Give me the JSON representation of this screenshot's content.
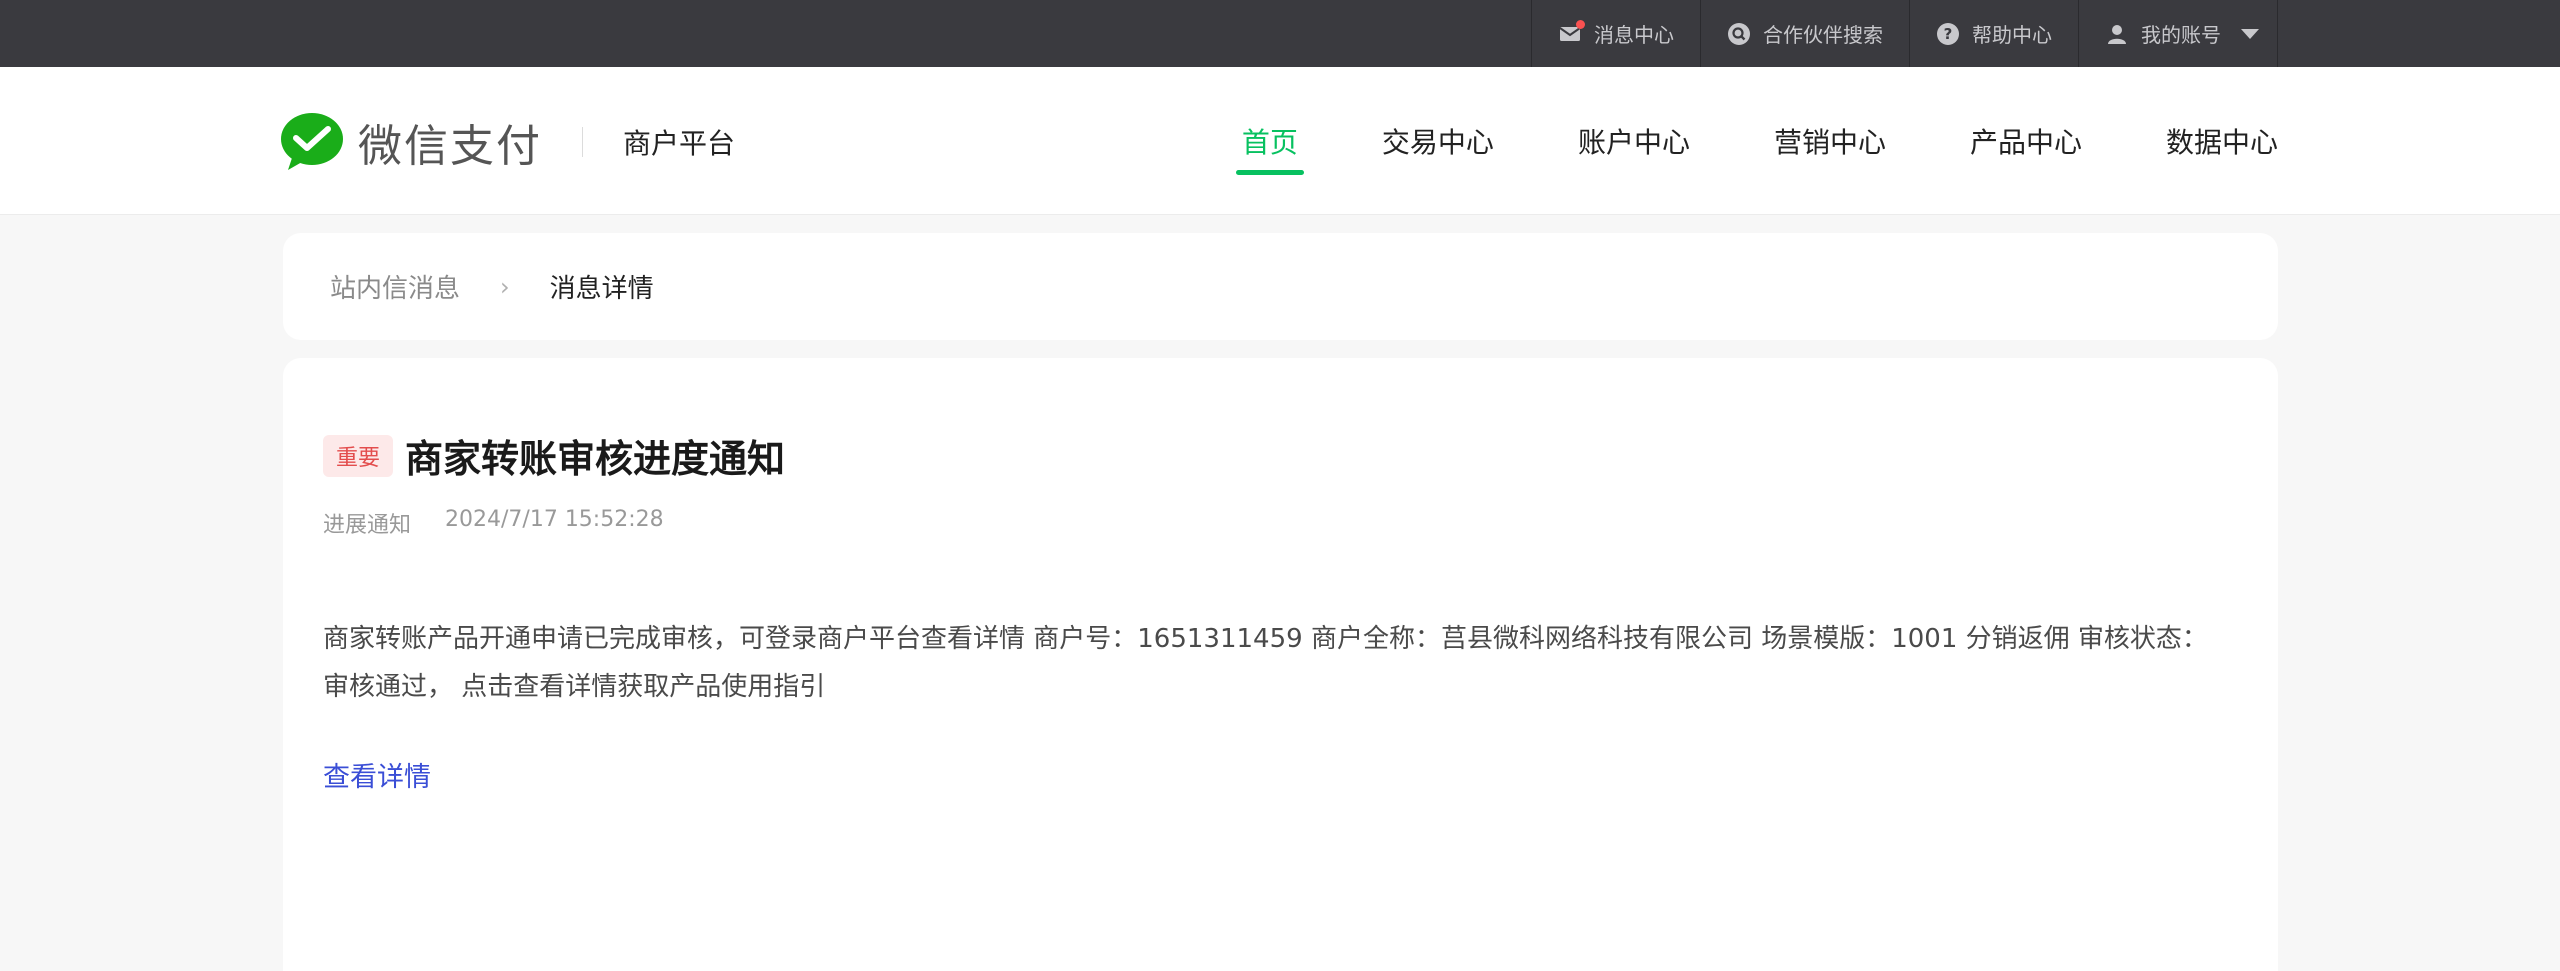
{
  "topbar": {
    "items": [
      {
        "label": "消息中心",
        "icon": "mail-icon"
      },
      {
        "label": "合作伙伴搜索",
        "icon": "search-icon"
      },
      {
        "label": "帮助中心",
        "icon": "help-icon"
      },
      {
        "label": "我的账号",
        "icon": "user-icon"
      }
    ]
  },
  "header": {
    "logo_text": "微信支付",
    "logo_sub": "商户平台",
    "nav": [
      {
        "label": "首页",
        "active": true
      },
      {
        "label": "交易中心"
      },
      {
        "label": "账户中心"
      },
      {
        "label": "营销中心"
      },
      {
        "label": "产品中心"
      },
      {
        "label": "数据中心"
      }
    ]
  },
  "breadcrumb": {
    "parent": "站内信消息",
    "separator": "›",
    "current": "消息详情"
  },
  "message": {
    "badge": "重要",
    "title": "商家转账审核进度通知",
    "category": "进展通知",
    "time": "2024/7/17 15:52:28",
    "body": "商家转账产品开通申请已完成审核，可登录商户平台查看详情 商户号：1651311459 商户全称：莒县微科网络科技有限公司 场景模版：1001 分销返佣 审核状态：审核通过， 点击查看详情获取产品使用指引",
    "link_label": "查看详情"
  },
  "colors": {
    "brand": "#07c160",
    "topbar_bg": "#3a3a3f",
    "badge_bg": "#fde9e9",
    "badge_text": "#e34d4d",
    "link": "#3a4ed6"
  }
}
